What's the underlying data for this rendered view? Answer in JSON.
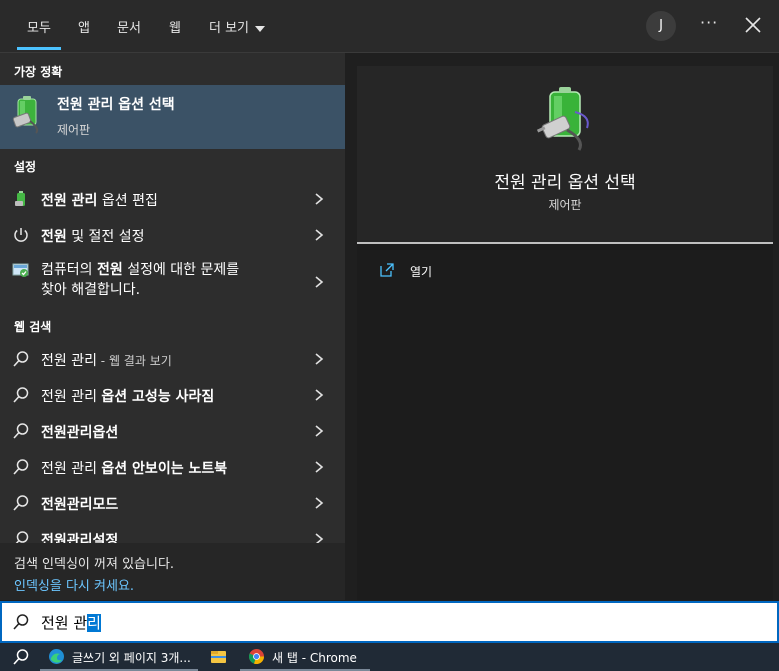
{
  "tabs": [
    "모두",
    "앱",
    "문서",
    "웹",
    "더 보기"
  ],
  "user_initial": "J",
  "more_options": "···",
  "sections": {
    "best_match": "가장 정확",
    "settings": "설정",
    "web_search": "웹 검색"
  },
  "best_match": {
    "title": "전원 관리 옵션 선택",
    "subtitle": "제어판",
    "icon": "battery-plug-icon"
  },
  "settings_items": [
    {
      "label_bold": "전원 관리",
      "label_rest": " 옵션 편집",
      "icon": "battery-icon"
    },
    {
      "label_bold": "전원",
      "label_rest": " 및 절전 설정",
      "icon": "power-icon"
    },
    {
      "line1_pre": "컴퓨터의 ",
      "line1_bold": "전원",
      "line1_post": " 설정에 대한 문제를",
      "line2": "찾아 해결합니다.",
      "icon": "troubleshoot-icon"
    }
  ],
  "web_items": [
    {
      "label": "전원 관리",
      "suffix": " - 웹 결과 보기"
    },
    {
      "label": "전원 관리 ",
      "bold": "옵션 고성능 사라짐"
    },
    {
      "label": "전원관리옵션"
    },
    {
      "label": "전원 관리 ",
      "bold": "옵션 안보이는 노트북"
    },
    {
      "label": "전원관리모드"
    },
    {
      "label": "전원관리설정"
    }
  ],
  "index_notice": {
    "text": "검색 인덱싱이 꺼져 있습니다.",
    "link": "인덱싱을 다시 켜세요."
  },
  "preview": {
    "title": "전원 관리 옵션 선택",
    "subtitle": "제어판",
    "open_label": "열기"
  },
  "search": {
    "query_before": "전원 관",
    "query_selected": "리"
  },
  "taskbar": [
    {
      "label": "글쓰기 외 페이지 3개...",
      "icon": "edge-icon"
    },
    {
      "label": "",
      "icon": "file-explorer-icon"
    },
    {
      "label": "새 탭 - Chrome",
      "icon": "chrome-icon"
    }
  ],
  "colors": {
    "accent": "#4cc2ff",
    "selected_row": "#3b5266",
    "link": "#6cc6ff",
    "search_border": "#0067c0"
  }
}
